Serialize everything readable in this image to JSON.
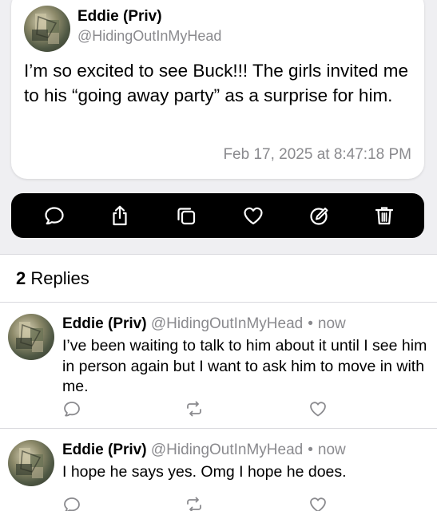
{
  "post": {
    "author_name": "Eddie (Priv)",
    "author_handle": "@HidingOutInMyHead",
    "text": "I’m so excited to see Buck!!! The girls invited me to his “going away party” as a surprise for him.",
    "timestamp": "Feb 17, 2025 at 8:47:18 PM",
    "avatar_icon": "avatar-photo"
  },
  "actions": [
    {
      "icon": "comment-icon"
    },
    {
      "icon": "share-icon"
    },
    {
      "icon": "copy-icon"
    },
    {
      "icon": "heart-icon"
    },
    {
      "icon": "edit-icon"
    },
    {
      "icon": "trash-icon"
    }
  ],
  "replies_header": {
    "count": "2",
    "label": "Replies"
  },
  "replies": [
    {
      "author_name": "Eddie (Priv)",
      "author_handle": "@HidingOutInMyHead",
      "separator": "•",
      "time": "now",
      "text": "I’ve been waiting to talk to him about it until I see him in person again but I want to ask him to move in with me."
    },
    {
      "author_name": "Eddie (Priv)",
      "author_handle": "@HidingOutInMyHead",
      "separator": "•",
      "time": "now",
      "text": "I hope he says yes. Omg I hope he does."
    }
  ],
  "colors": {
    "background": "#efeff2",
    "card": "#ffffff",
    "action_bar": "#000000",
    "secondary_text": "#8a8a8e",
    "reply_icon_color": "#8a8a8e"
  }
}
